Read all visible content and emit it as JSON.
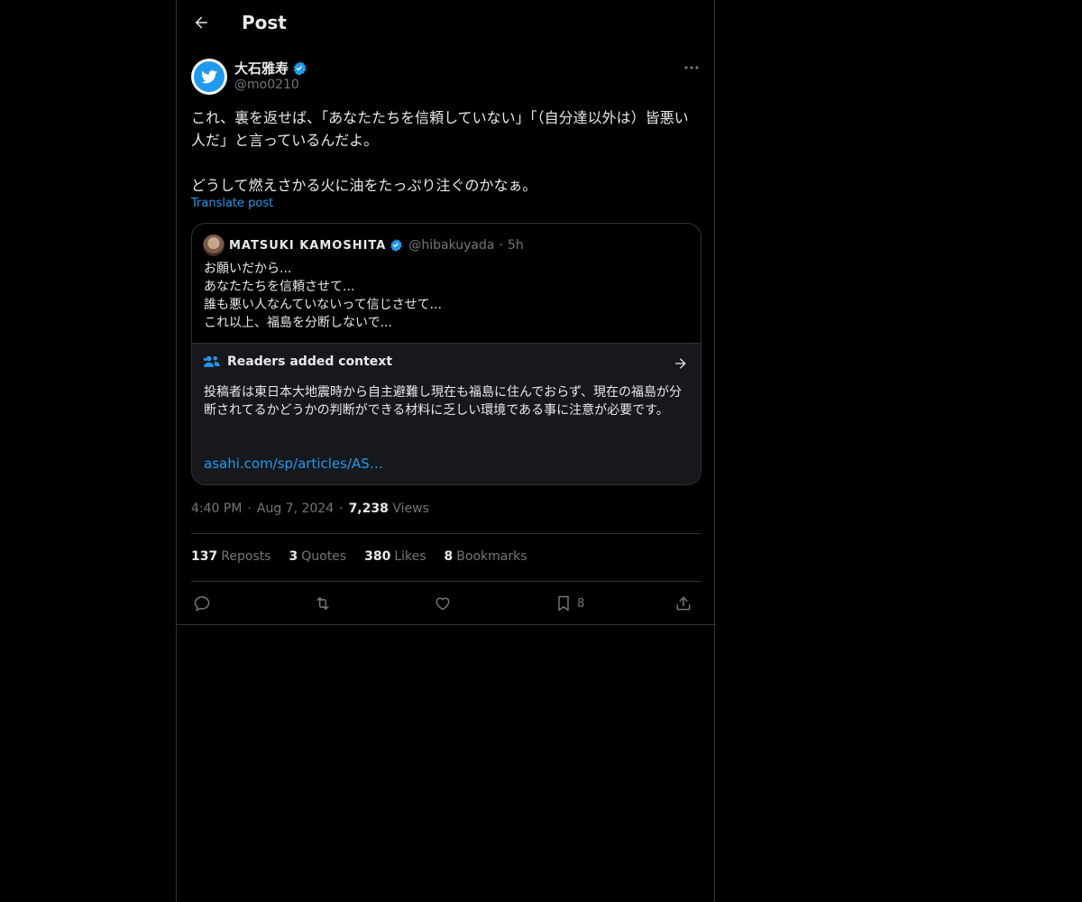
{
  "header": {
    "title": "Post",
    "back_icon": "arrow-left-icon"
  },
  "author": {
    "name": "大石雅寿",
    "handle": "@mo0210",
    "verified": true,
    "avatar_icon": "twitter-bird-icon"
  },
  "post": {
    "text": "これ、裏を返せば、「あなたたちを信頼していない」「（自分達以外は）皆悪い人だ」と言っているんだよ。\n\nどうして燃えさかる火に油をたっぷり注ぐのかなぁ。",
    "translate_label": "Translate post"
  },
  "quote": {
    "name": "MATSUKI KAMOSHITA",
    "handle": "@hibakuyada",
    "separator": "·",
    "time": "5h",
    "verified": true,
    "text": "お願いだから...\nあなたたちを信頼させて...\n誰も悪い人なんていないって信じさせて...\nこれ以上、福島を分断しないで..."
  },
  "note": {
    "title": "Readers added context",
    "text": "投稿者は東日本大地震時から自主避難し現在も福島に住んでおらず、現在の福島が分断されてるかどうかの判断ができる材料に乏しい環境である事に注意が必要です。",
    "link": "asahi.com/sp/articles/AS…"
  },
  "meta": {
    "time": "4:40 PM",
    "separator": "·",
    "date": "Aug 7, 2024",
    "views_count": "7,238",
    "views_label": "Views"
  },
  "stats": {
    "reposts_count": "137",
    "reposts_label": "Reposts",
    "quotes_count": "3",
    "quotes_label": "Quotes",
    "likes_count": "380",
    "likes_label": "Likes",
    "bookmarks_count": "8",
    "bookmarks_label": "Bookmarks"
  },
  "actions": {
    "bookmark_count": "8"
  },
  "colors": {
    "background": "#000000",
    "text": "#e7e9ea",
    "muted": "#71767b",
    "accent": "#1d9bf0",
    "border": "#2f3336",
    "note_bg": "#16181c"
  }
}
